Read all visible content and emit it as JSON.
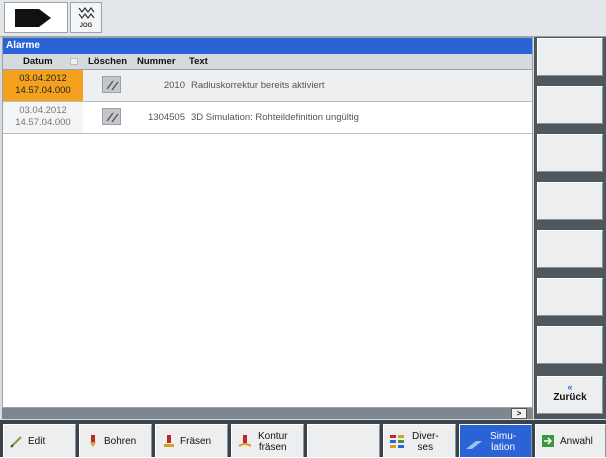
{
  "topbar": {
    "jog_label": "JOG"
  },
  "panel": {
    "title": "Alarme",
    "columns": {
      "date": "Datum",
      "delete": "Löschen",
      "number": "Nummer",
      "text": "Text"
    },
    "rows": [
      {
        "date": "03.04.2012",
        "time": "14.57.04.000",
        "number": "2010",
        "text": "Radiuskorrektur bereits aktiviert",
        "highlighted": true
      },
      {
        "date": "03.04.2012",
        "time": "14.57.04.000",
        "number": "1304505",
        "text": "3D Simulation: Rohteildefinition ungültig",
        "highlighted": false
      }
    ]
  },
  "status": {
    "page_button": ">"
  },
  "right_softkeys": {
    "back_chevron": "«",
    "back_label": "Zurück"
  },
  "bottom_softkeys": [
    {
      "label": "Edit",
      "icon": "pencil-icon"
    },
    {
      "label": "Bohren",
      "icon": "drill-icon"
    },
    {
      "label": "Fräsen",
      "icon": "mill-icon"
    },
    {
      "label1": "Kontur",
      "label2": "fräsen",
      "icon": "contour-mill-icon"
    },
    {
      "label": ""
    },
    {
      "label1": "Diver-",
      "label2": "ses",
      "icon": "misc-grid-icon"
    },
    {
      "label1": "Simu-",
      "label2": "lation",
      "icon": "simulation-icon",
      "active": true
    },
    {
      "label": "Anwahl",
      "icon": "select-icon"
    }
  ],
  "colors": {
    "accent": "#2a63d6",
    "alarm_highlight": "#f4a21d"
  }
}
